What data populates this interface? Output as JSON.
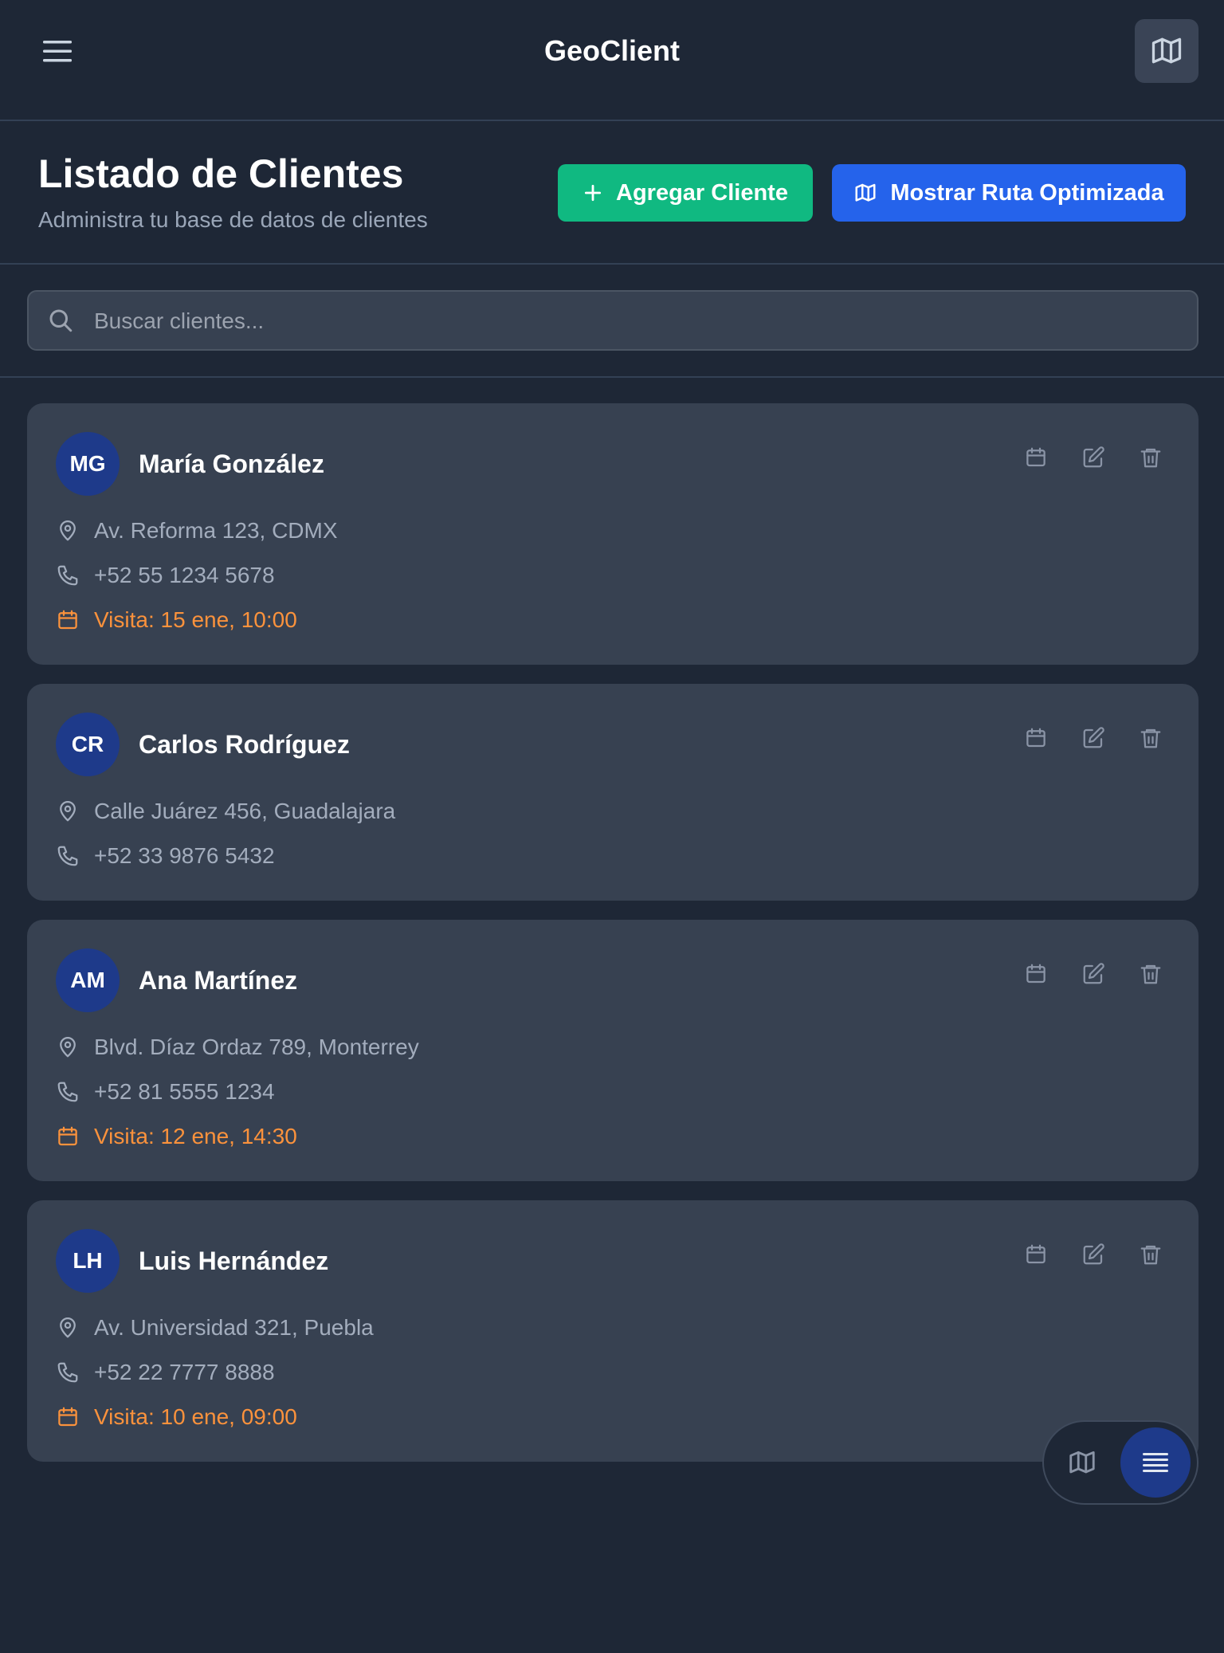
{
  "app": {
    "title": "GeoClient"
  },
  "header": {
    "title": "Listado de Clientes",
    "subtitle": "Administra tu base de datos de clientes",
    "add_button_label": "Agregar Cliente",
    "route_button_label": "Mostrar Ruta Optimizada"
  },
  "search": {
    "placeholder": "Buscar clientes...",
    "value": ""
  },
  "clients": [
    {
      "initials": "MG",
      "name": "María González",
      "address": "Av. Reforma 123, CDMX",
      "phone": "+52 55 1234 5678",
      "visit": "Visita: 15 ene, 10:00"
    },
    {
      "initials": "CR",
      "name": "Carlos Rodríguez",
      "address": "Calle Juárez 456, Guadalajara",
      "phone": "+52 33 9876 5432",
      "visit": null
    },
    {
      "initials": "AM",
      "name": "Ana Martínez",
      "address": "Blvd. Díaz Ordaz 789, Monterrey",
      "phone": "+52 81 5555 1234",
      "visit": "Visita: 12 ene, 14:30"
    },
    {
      "initials": "LH",
      "name": "Luis Hernández",
      "address": "Av. Universidad 321, Puebla",
      "phone": "+52 22 7777 8888",
      "visit": "Visita: 10 ene, 09:00"
    }
  ],
  "icons": {
    "menu": "menu-icon",
    "map": "map-icon",
    "plus": "plus-icon",
    "search": "search-icon",
    "location": "map-pin-icon",
    "phone": "phone-icon",
    "calendar": "calendar-icon",
    "edit": "edit-icon",
    "delete": "trash-icon",
    "list": "list-icon"
  },
  "colors": {
    "background": "#1e2736",
    "card": "#374151",
    "add_button": "#10b981",
    "route_button": "#2563eb",
    "avatar": "#1e3a8a",
    "visit_text": "#fb923c"
  },
  "view_switch": {
    "active": "list"
  }
}
